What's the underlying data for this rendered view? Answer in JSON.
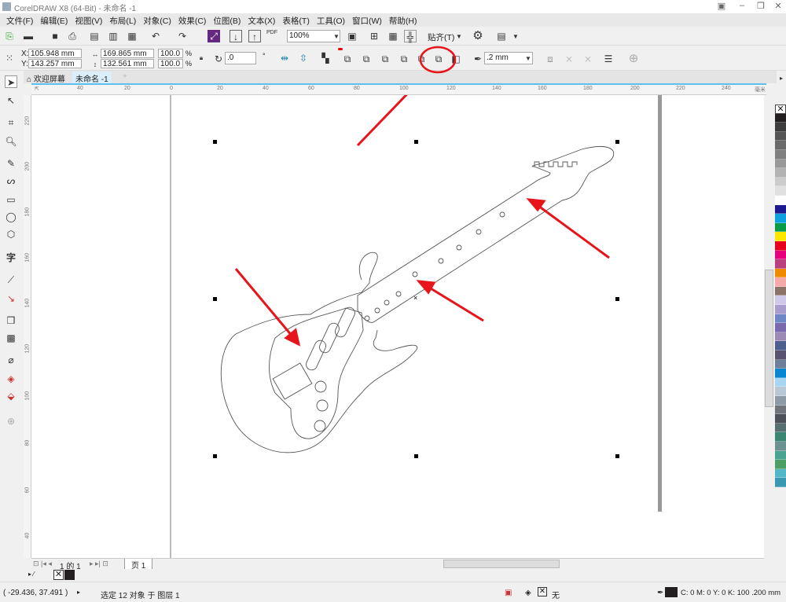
{
  "window": {
    "title": "CorelDRAW X8 (64-Bit) - 未命名 -1"
  },
  "menu": [
    "文件(F)",
    "编辑(E)",
    "视图(V)",
    "布局(L)",
    "对象(C)",
    "效果(C)",
    "位图(B)",
    "文本(X)",
    "表格(T)",
    "工具(O)",
    "窗口(W)",
    "帮助(H)"
  ],
  "toolbar": {
    "zoom": "100%",
    "snap_label": "贴齐(T)",
    "pdf_label": "PDF"
  },
  "props": {
    "x": "105.948 mm",
    "y": "143.257 mm",
    "width": "169.865 mm",
    "height": "132.561 mm",
    "scale_x": "100.0",
    "scale_y": "100.0",
    "percent": "%",
    "rotation": ".0",
    "outline_width": ".2 mm",
    "x_label": "X:",
    "y_label": "Y:"
  },
  "tabs": [
    {
      "label": "欢迎屏幕"
    },
    {
      "label": "未命名 -1"
    }
  ],
  "ruler_top": [
    "60",
    "40",
    "20",
    "0",
    "20",
    "40",
    "60",
    "80",
    "100",
    "120",
    "140",
    "160",
    "180",
    "200",
    "220",
    "240",
    "毫米"
  ],
  "ruler_left": [
    "220",
    "200",
    "180",
    "160",
    "140",
    "120",
    "100",
    "80",
    "60",
    "40"
  ],
  "pagenav": {
    "pages": "1 的 1",
    "page_tab": "页 1"
  },
  "status": {
    "coords": "( -29.436, 37.491 )",
    "selection": "选定 12 对象 于 图层 1",
    "fill": "无",
    "outline_color": "C: 0 M: 0 Y: 0 K: 100  .200 mm"
  },
  "palette": [
    "#231f20",
    "#3d3d3d",
    "#555555",
    "#6b6b6b",
    "#808080",
    "#999999",
    "#b3b3b3",
    "#cccccc",
    "#e0e0e0",
    "#ffffff",
    "#1b1b8f",
    "#0fa0e0",
    "#0a9b48",
    "#ffe600",
    "#e5001e",
    "#e6007e",
    "#b8407f",
    "#f08a00",
    "#f4aaa8",
    "#8b7367",
    "#cfc8e8",
    "#a89ccc",
    "#6f87c4",
    "#7a69ac",
    "#9b8ab4",
    "#4d5f8c",
    "#5a5370",
    "#6d7f99",
    "#0a86d1",
    "#a8d5f0",
    "#b9c8d6",
    "#8c9aa5",
    "#6f757b",
    "#4c5257",
    "#56706f",
    "#3b8573",
    "#6d9090",
    "#4aa290",
    "#4ca065",
    "#53b7c9",
    "#3a98b0"
  ],
  "annotation_color": "#e8141b"
}
